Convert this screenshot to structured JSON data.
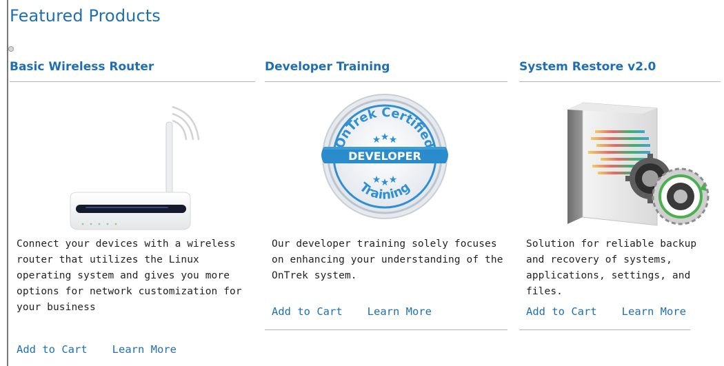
{
  "section": {
    "title": "Featured Products"
  },
  "carousel": {
    "indicator_icon": "circle-dot-icon"
  },
  "products": [
    {
      "name": "Basic Wireless Router",
      "image": "wireless-router-image",
      "description": "Connect your devices with a wireless router that utilizes the Linux operating system and gives you more options for network customization for your business",
      "add_to_cart": "Add to Cart",
      "learn_more": "Learn More"
    },
    {
      "name": "Developer Training",
      "image": "ontrek-certified-badge",
      "badge_top": "OnTrek Certified",
      "badge_band": "DEVELOPER",
      "badge_bottom": "Training",
      "description": "Our developer training solely focuses on enhancing your understanding of the OnTrek system.",
      "add_to_cart": "Add to Cart",
      "learn_more": "Learn More"
    },
    {
      "name": "System Restore v2.0",
      "image": "software-box-gears",
      "description": "Solution for reliable backup and recovery of systems, applications, settings, and files.",
      "add_to_cart": "Add to Cart",
      "learn_more": "Learn More"
    }
  ],
  "colors": {
    "link": "#1f6fb2",
    "title": "#1f6fb2",
    "rule": "#b3b3b3",
    "badge_blue": "#2a8ccc"
  }
}
